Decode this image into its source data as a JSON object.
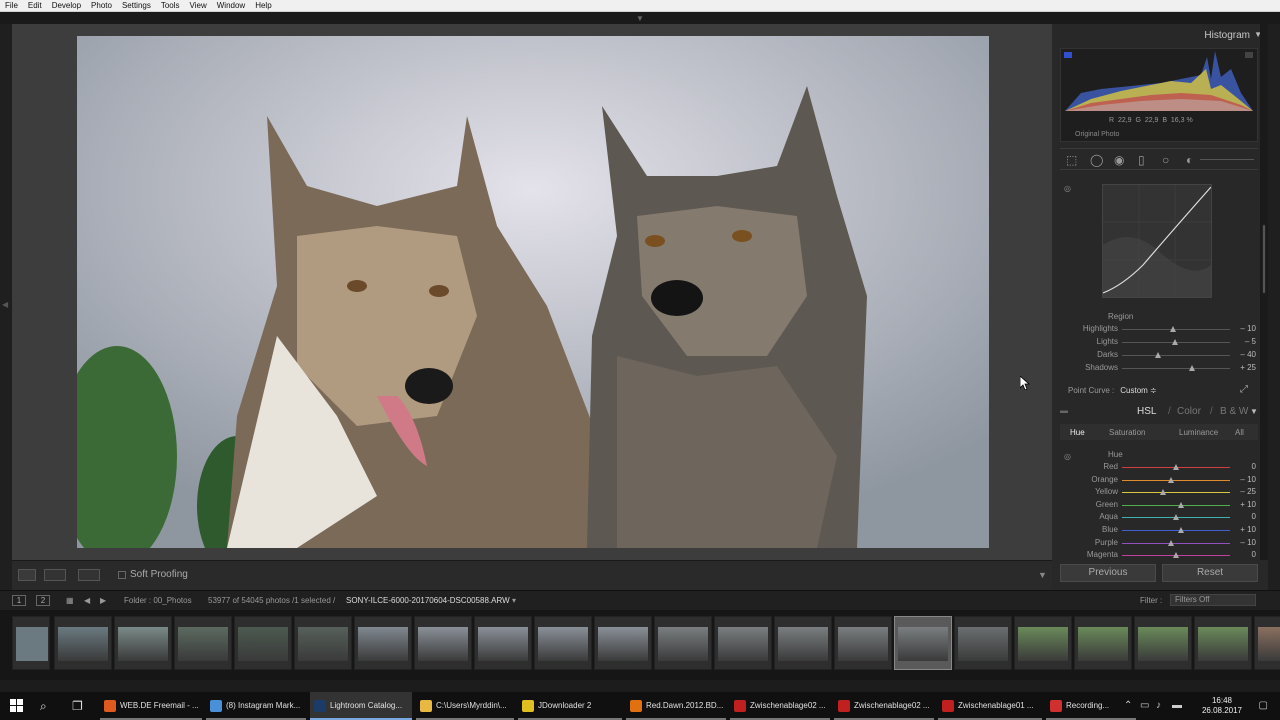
{
  "menu": [
    "File",
    "Edit",
    "Develop",
    "Photo",
    "Settings",
    "Tools",
    "View",
    "Window",
    "Help"
  ],
  "toolbar": {
    "soft_proofing": "Soft Proofing"
  },
  "panel": {
    "histogram_title": "Histogram",
    "rgb": {
      "r_label": "R",
      "r": "22,9",
      "g_label": "G",
      "g": "22,9",
      "b_label": "B",
      "b": "16,3",
      "unit": "%"
    },
    "original_photo": "Original Photo",
    "region_label": "Region",
    "tone_sliders": [
      {
        "label": "Highlights",
        "value": "– 10",
        "pos": 0.47
      },
      {
        "label": "Lights",
        "value": "– 5",
        "pos": 0.49
      },
      {
        "label": "Darks",
        "value": "– 40",
        "pos": 0.33
      },
      {
        "label": "Shadows",
        "value": "+ 25",
        "pos": 0.65
      }
    ],
    "point_curve_label": "Point Curve :",
    "point_curve_value": "Custom ≑",
    "hsl": {
      "hsl": "HSL",
      "sep1": "/",
      "color": "Color",
      "sep2": "/",
      "bw": "B & W"
    },
    "hsl_tabs": [
      "Hue",
      "Saturation",
      "Luminance",
      "All"
    ],
    "hue_label": "Hue",
    "hue_sliders": [
      {
        "label": "Red",
        "value": "0",
        "pos": 0.5,
        "color": "#d04040"
      },
      {
        "label": "Orange",
        "value": "– 10",
        "pos": 0.45,
        "color": "#e08a30"
      },
      {
        "label": "Yellow",
        "value": "– 25",
        "pos": 0.38,
        "color": "#d8c840"
      },
      {
        "label": "Green",
        "value": "+ 10",
        "pos": 0.55,
        "color": "#50b050"
      },
      {
        "label": "Aqua",
        "value": "0",
        "pos": 0.5,
        "color": "#40b0b0"
      },
      {
        "label": "Blue",
        "value": "+ 10",
        "pos": 0.55,
        "color": "#4060d0"
      },
      {
        "label": "Purple",
        "value": "– 10",
        "pos": 0.45,
        "color": "#9050c0"
      },
      {
        "label": "Magenta",
        "value": "0",
        "pos": 0.5,
        "color": "#c040a0"
      }
    ],
    "previous": "Previous",
    "reset": "Reset"
  },
  "filmbar": {
    "page1": "1",
    "page2": "2",
    "folder": "Folder : 00_Photos",
    "count": "53977 of 54045 photos /1 selected /",
    "filename": "SONY-ILCE-6000-20170604-DSC00588.ARW",
    "filter_label": "Filter :",
    "filter_value": "Filters Off"
  },
  "taskbar": {
    "tasks": [
      {
        "label": "WEB.DE Freemail - ...",
        "color": "#e05a20",
        "state": "open"
      },
      {
        "label": "(8) Instagram Mark...",
        "color": "#4a90d9",
        "state": "open"
      },
      {
        "label": "Lightroom Catalog...",
        "color": "#1c3b66",
        "state": "active"
      },
      {
        "label": "C:\\Users\\Myrddin\\...",
        "color": "#e8b840",
        "state": "open"
      },
      {
        "label": "JDownloader 2",
        "color": "#e0c020",
        "state": "open"
      },
      {
        "label": "Red.Dawn.2012.BD...",
        "color": "#e07010",
        "state": "open"
      },
      {
        "label": "Zwischenablage02 ...",
        "color": "#c02020",
        "state": "open"
      },
      {
        "label": "Zwischenablage02 ...",
        "color": "#c02020",
        "state": "open"
      },
      {
        "label": "Zwischenablage01 ...",
        "color": "#c02020",
        "state": "open"
      },
      {
        "label": "Recording...",
        "color": "#d03030",
        "state": "open"
      }
    ],
    "time": "16:48",
    "date": "26.08.2017"
  },
  "colors": {
    "accent": "#7aa8e0",
    "panel_bg": "#282828"
  }
}
